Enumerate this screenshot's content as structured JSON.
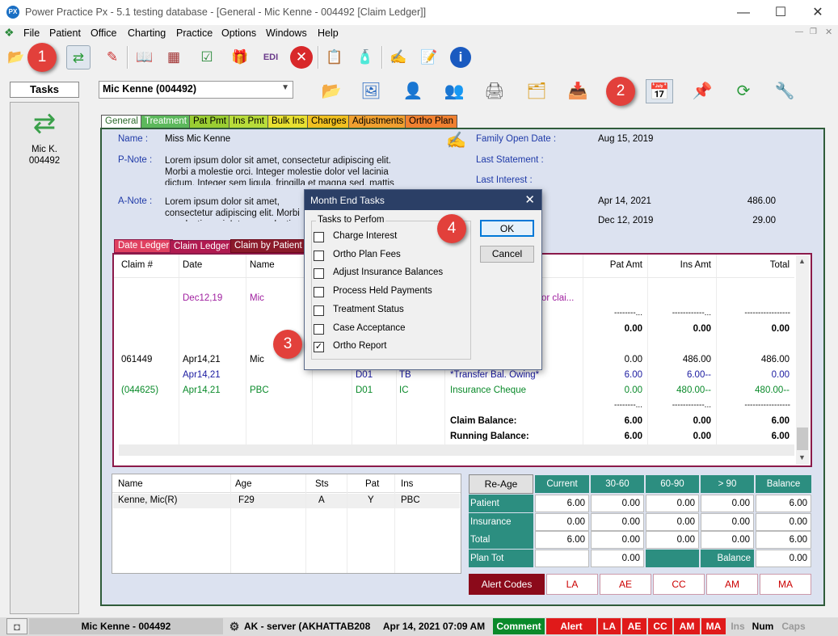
{
  "window": {
    "title": "Power Practice Px - 5.1 testing database - [General - Mic Kenne - 004492 [Claim Ledger]]",
    "minimize": "—",
    "maximize": "☐",
    "close": "✕"
  },
  "menu": [
    "File",
    "Patient",
    "Office",
    "Charting",
    "Practice",
    "Options",
    "Windows",
    "Help"
  ],
  "tasks": {
    "header": "Tasks",
    "patient_line1": "Mic K.",
    "patient_line2": "004492"
  },
  "patient_combo": "Mic Kenne (004492)",
  "tabs": [
    "General",
    "Treatment",
    "Pat Pmt",
    "Ins Pmt",
    "Bulk Ins",
    "Charges",
    "Adjustments",
    "Ortho Plan"
  ],
  "general": {
    "name_label": "Name :",
    "name_value": "Miss Mic Kenne",
    "pnote_label": "P-Note :",
    "pnote_text": "Lorem ipsum dolor sit amet, consectetur adipiscing elit. Morbi a molestie orci. Integer molestie dolor vel lacinia dictum. Integer sem ligula, fringilla et magna sed, mattis dapibus arcu.",
    "anote_label": "A-Note :",
    "anote_text": "Lorem ipsum dolor sit amet, consectetur adipiscing elit. Morbi a molestie orci. Integer molestie dolor vel lacinia dictum. Integer sem ligula, fringilla et magna sed, mattis dapibus arcu.",
    "family_open_label": "Family Open Date :",
    "family_open_value": "Aug 15, 2019",
    "last_statement_label": "Last Statement :",
    "last_interest_label": "Last Interest :",
    "row4_date": "Apr 14, 2021",
    "row4_amount": "486.00",
    "row5_date": "Dec 12, 2019",
    "row5_amount": "29.00"
  },
  "ledger_tabs": [
    "Date Ledger",
    "Claim Ledger",
    "Claim by Patient"
  ],
  "ledger": {
    "headers": {
      "claim": "Claim #",
      "date": "Date",
      "name": "Name",
      "pat_amt": "Pat Amt",
      "ins_amt": "Ins Amt",
      "total": "Total"
    },
    "row1": {
      "date": "Dec12,19",
      "name": "Mic",
      "desc": "or clai..."
    },
    "sep1": {
      "pat": "--------...",
      "ins": "------------...",
      "total": "-----------------"
    },
    "totals1": {
      "pat": "0.00",
      "ins": "0.00",
      "total": "0.00"
    },
    "row2": {
      "claim": "061449",
      "date": "Apr14,21",
      "name": "Mic",
      "pat": "0.00",
      "ins": "486.00",
      "total": "486.00"
    },
    "row3": {
      "date": "Apr14,21",
      "code": "D01",
      "type": "TB",
      "desc": "*Transfer Bal. Owing*",
      "pat": "6.00",
      "ins": "6.00--",
      "total": "0.00"
    },
    "row4": {
      "claim": "(044625)",
      "date": "Apr14,21",
      "name": "PBC",
      "code": "D01",
      "type": "IC",
      "desc": "Insurance Cheque",
      "pat": "0.00",
      "ins": "480.00--",
      "total": "480.00--"
    },
    "sep2": {
      "pat": "--------...",
      "ins": "------------...",
      "total": "-----------------"
    },
    "claim_balance": {
      "label": "Claim Balance:",
      "pat": "6.00",
      "ins": "0.00",
      "total": "6.00"
    },
    "running_balance": {
      "label": "Running Balance:",
      "pat": "6.00",
      "ins": "0.00",
      "total": "6.00"
    }
  },
  "modal": {
    "title": "Month End Tasks",
    "group": "Tasks to Perfom",
    "items": [
      {
        "label": "Charge Interest",
        "checked": false
      },
      {
        "label": "Ortho Plan Fees",
        "checked": false
      },
      {
        "label": "Adjust Insurance Balances",
        "checked": false
      },
      {
        "label": "Process Held Payments",
        "checked": false
      },
      {
        "label": "Treatment Status",
        "checked": false
      },
      {
        "label": "Case Acceptance",
        "checked": false
      },
      {
        "label": "Ortho Report",
        "checked": true
      }
    ],
    "ok": "OK",
    "cancel": "Cancel",
    "check_mark": "✓"
  },
  "family": {
    "headers": {
      "name": "Name",
      "age": "Age",
      "sts": "Sts",
      "pat": "Pat",
      "ins": "Ins"
    },
    "row": {
      "name": "Kenne, Mic(R)",
      "age": "F29",
      "sts": "A",
      "pat": "Y",
      "ins": "PBC"
    }
  },
  "aging": {
    "reage": "Re-Age",
    "headers": [
      "Current",
      "30-60",
      "60-90",
      "> 90",
      "Balance"
    ],
    "rows": [
      {
        "label": "Patient",
        "vals": [
          "6.00",
          "0.00",
          "0.00",
          "0.00",
          "6.00"
        ]
      },
      {
        "label": "Insurance",
        "vals": [
          "0.00",
          "0.00",
          "0.00",
          "0.00",
          "0.00"
        ]
      },
      {
        "label": "Total",
        "vals": [
          "6.00",
          "0.00",
          "0.00",
          "0.00",
          "6.00"
        ]
      }
    ],
    "plan_tot": "Plan Tot",
    "plan_val": "0.00",
    "balance_label": "Balance",
    "balance_val": "0.00"
  },
  "alerts": {
    "label": "Alert Codes",
    "codes": [
      "LA",
      "AE",
      "CC",
      "AM",
      "MA"
    ]
  },
  "status": {
    "patient": "Mic Kenne - 004492",
    "server": "AK - server (AKHATTAB208",
    "datetime": "Apr 14, 2021 07:09 AM",
    "comment": "Comment",
    "alert": "Alert",
    "codes": [
      "LA",
      "AE",
      "CC",
      "AM",
      "MA"
    ],
    "ins": "Ins",
    "num": "Num",
    "caps": "Caps"
  },
  "badges": [
    "1",
    "2",
    "3",
    "4"
  ],
  "colors": {
    "badge": "#e2403b",
    "teal": "#2c8e80",
    "ledger_border": "#8b1a4a",
    "alert_dark": "#8b0a1a"
  }
}
